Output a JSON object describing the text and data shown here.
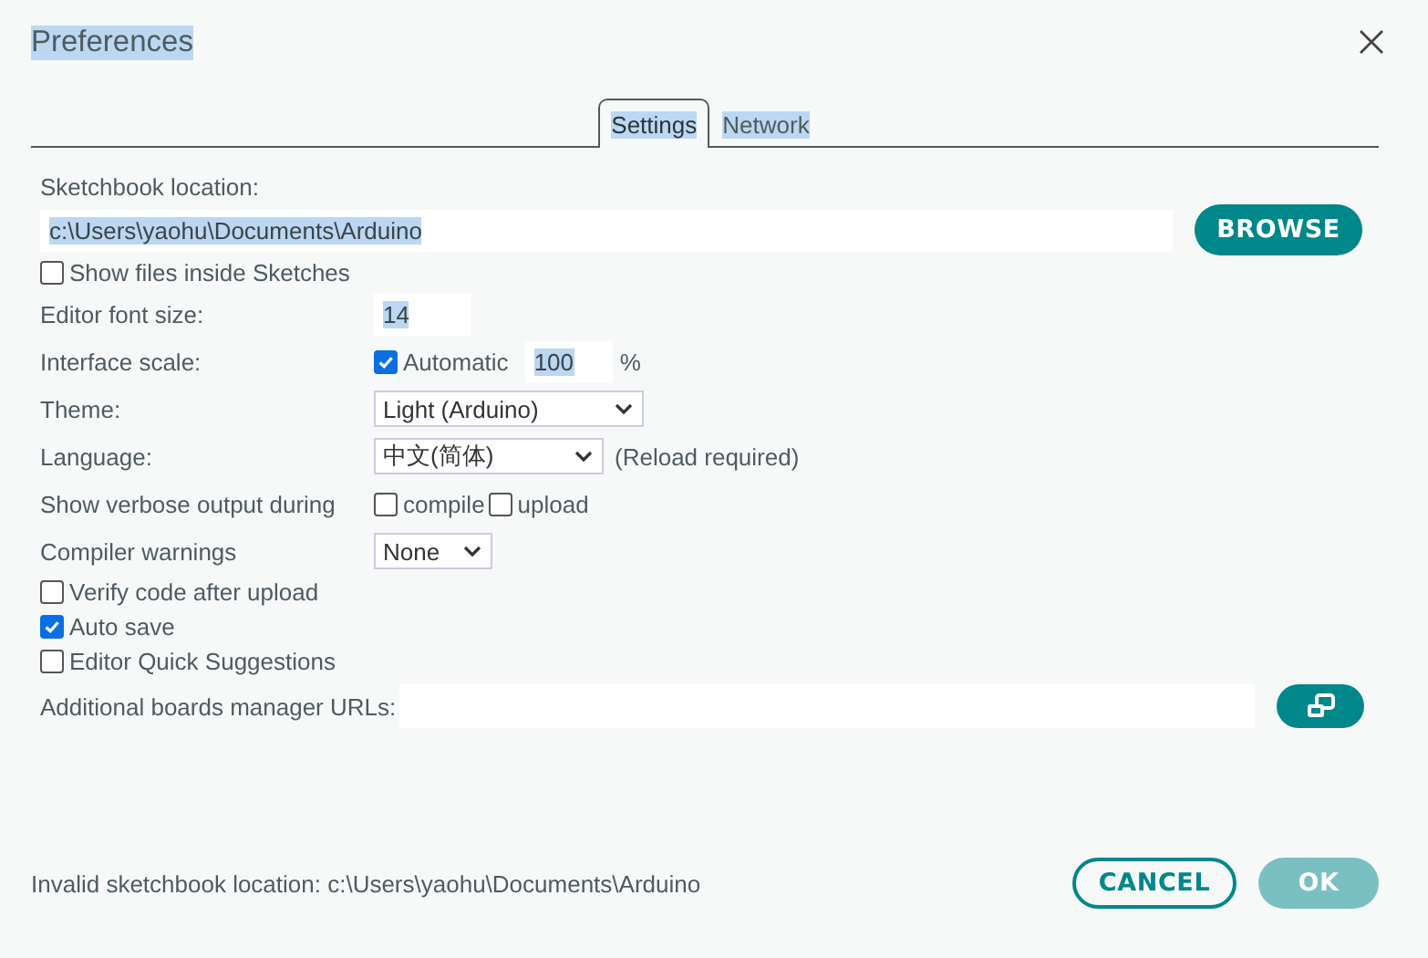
{
  "window": {
    "title": "Preferences",
    "title_highlighted": true
  },
  "tabs": [
    {
      "label": "Settings",
      "selected": true,
      "highlighted": true
    },
    {
      "label": "Network",
      "selected": false,
      "highlighted": true
    }
  ],
  "settings": [
    {
      "kind": "path",
      "label": "Sketchbook location:",
      "value": "c:\\Users\\yaohu\\Documents\\Arduino",
      "highlighted": true,
      "button": "BROWSE"
    },
    {
      "kind": "checkbox",
      "label": "Show files inside Sketches",
      "checked": false
    },
    {
      "kind": "number",
      "label": "Editor font size:",
      "value": "14",
      "highlighted": true
    },
    {
      "kind": "scale",
      "label": "Interface scale:",
      "option": "Automatic",
      "checked": true,
      "value": "100",
      "highlighted": true,
      "unit": "%"
    },
    {
      "kind": "select",
      "label": "Theme:",
      "value": "Light (Arduino)"
    },
    {
      "kind": "select",
      "label": "Language:",
      "value": "中文(简体)",
      "note": "(Reload required)"
    },
    {
      "kind": "checks",
      "label": "Show verbose output during",
      "options": [
        {
          "label": "compile",
          "checked": false
        },
        {
          "label": "upload",
          "checked": false
        }
      ]
    },
    {
      "kind": "select",
      "label": "Compiler warnings",
      "value": "None"
    },
    {
      "kind": "checkbox",
      "label": "Verify code after upload",
      "checked": false
    },
    {
      "kind": "checkbox",
      "label": "Auto save",
      "checked": true
    },
    {
      "kind": "checkbox",
      "label": "Editor Quick Suggestions",
      "checked": false
    },
    {
      "kind": "urls",
      "label": "Additional boards manager URLs:"
    }
  ],
  "footer": {
    "message": "Invalid sketchbook location: c:\\Users\\yaohu\\Documents\\Arduino",
    "buttons": [
      {
        "label": "CANCEL",
        "kind": "secondary",
        "disabled": false
      },
      {
        "label": "OK",
        "kind": "primary",
        "disabled": true
      }
    ]
  }
}
